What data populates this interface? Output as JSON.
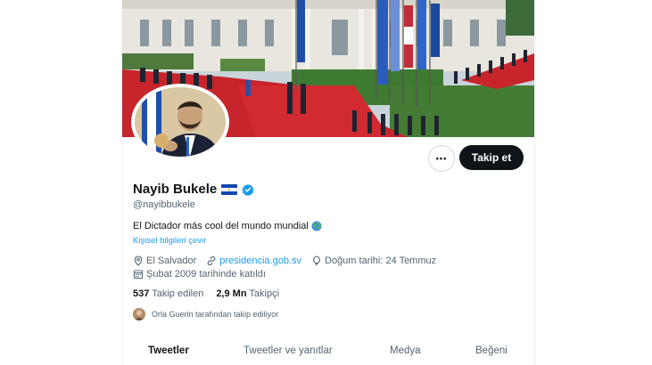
{
  "profile": {
    "name": "Nayib Bukele",
    "handle": "@nayibbukele",
    "bio": "El Dictador más cool del mundo mundial",
    "translate_label": "Kişisel bilgileri çevir",
    "location": "El Salvador",
    "website": "presidencia.gob.sv",
    "birthday": "Doğum tarihi: 24 Temmuz",
    "joined": "Şubat 2009 tarihinde katıldı"
  },
  "stats": {
    "following_count": "537",
    "following_label": "Takip edilen",
    "followers_count": "2,9 Mn",
    "followers_label": "Takipçi"
  },
  "followed_by": "Orla Guerin tarafından takip ediliyor",
  "actions": {
    "follow_label": "Takip et",
    "more_label": "•••"
  },
  "tabs": [
    {
      "label": "Tweetler",
      "active": true
    },
    {
      "label": "Tweetler ve yanıtlar",
      "active": false
    },
    {
      "label": "Medya",
      "active": false
    },
    {
      "label": "Beğeni",
      "active": false
    }
  ],
  "icons": {
    "flag": "el-salvador-flag-emoji",
    "verified": "verified-badge-icon",
    "globe": "globe-emoji",
    "location": "location-pin-icon",
    "link": "link-icon",
    "birthday": "balloon-icon",
    "calendar": "calendar-icon"
  },
  "colors": {
    "accent": "#1d9bf0",
    "text_primary": "#0f1419",
    "text_secondary": "#536471",
    "button_dark": "#0f1419"
  }
}
